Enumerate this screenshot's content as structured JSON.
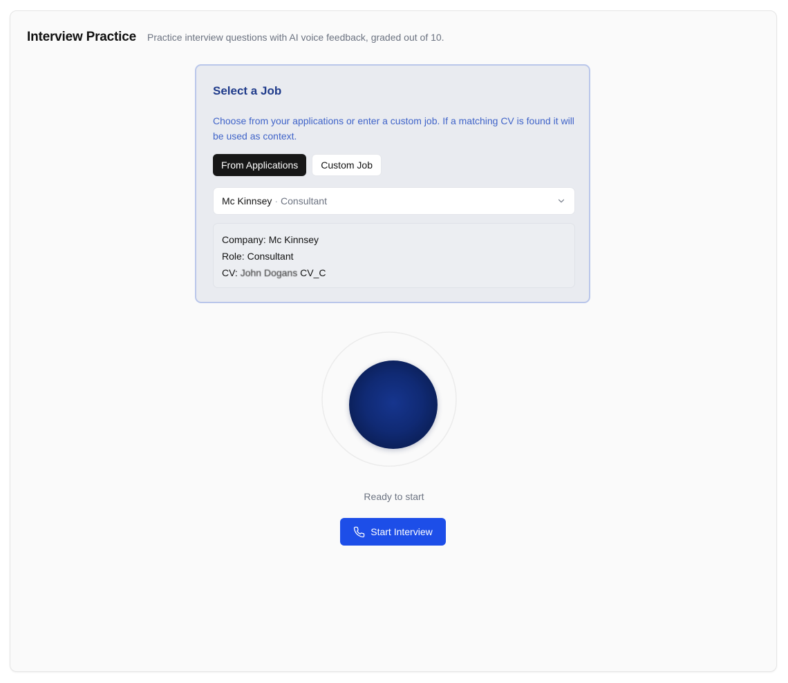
{
  "header": {
    "title": "Interview Practice",
    "subtitle": "Practice interview questions with AI voice feedback, graded out of 10."
  },
  "job_card": {
    "title": "Select a Job",
    "description": "Choose from your applications or enter a custom job. If a matching CV is found it will be used as context.",
    "tabs": [
      {
        "label": "From Applications",
        "active": true
      },
      {
        "label": "Custom Job",
        "active": false
      }
    ],
    "select": {
      "company": "Mc Kinnsey",
      "separator": "·",
      "role": "Consultant",
      "icon": "chevron-down-icon"
    },
    "details": {
      "company_label": "Company:",
      "company_value": "Mc Kinnsey",
      "role_label": "Role:",
      "role_value": "Consultant",
      "cv_label": "CV:",
      "cv_name": "John Dogans",
      "cv_suffix": "CV_C"
    }
  },
  "voice": {
    "status": "Ready to start",
    "orb_color": "#102a74"
  },
  "start_button": {
    "label": "Start Interview",
    "icon": "phone-icon",
    "color": "#1d4ee8"
  }
}
